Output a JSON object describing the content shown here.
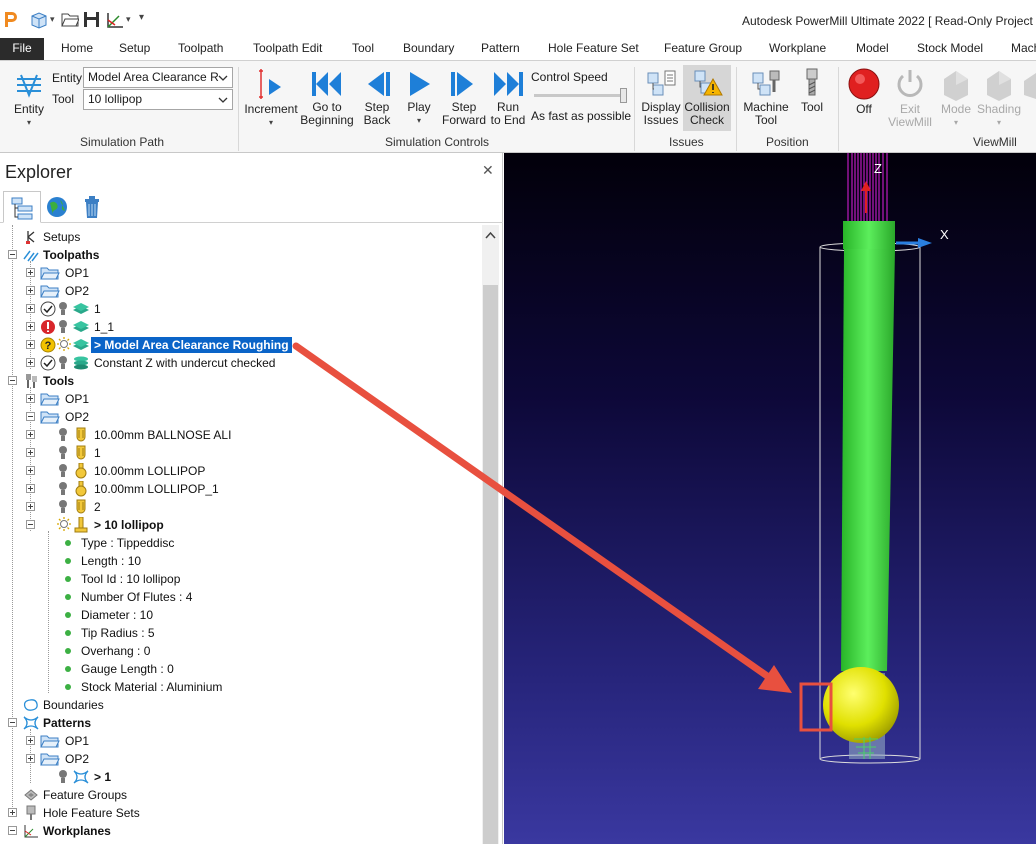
{
  "app": {
    "title": "Autodesk PowerMill Ultimate 2022   [ Read-Only Project *"
  },
  "tabs": [
    {
      "label": "File",
      "active": true
    },
    {
      "label": "Home"
    },
    {
      "label": "Setup"
    },
    {
      "label": "Toolpath"
    },
    {
      "label": "Toolpath Edit"
    },
    {
      "label": "Tool"
    },
    {
      "label": "Boundary"
    },
    {
      "label": "Pattern"
    },
    {
      "label": "Hole Feature Set"
    },
    {
      "label": "Feature Group"
    },
    {
      "label": "Workplane"
    },
    {
      "label": "Model"
    },
    {
      "label": "Stock Model"
    },
    {
      "label": "Mach"
    }
  ],
  "ribbon": {
    "simulation_path": {
      "group_label": "Simulation Path",
      "entity_button": "Entity",
      "entity_label": "Entity",
      "entity_value": "Model Area Clearance R",
      "tool_label": "Tool",
      "tool_value": "10 lollipop"
    },
    "simulation_controls": {
      "group_label": "Simulation Controls",
      "increment": "Increment",
      "go_to_beginning_1": "Go to",
      "go_to_beginning_2": "Beginning",
      "step_back_1": "Step",
      "step_back_2": "Back",
      "play": "Play",
      "step_forward_1": "Step",
      "step_forward_2": "Forward",
      "run_to_end_1": "Run",
      "run_to_end_2": "to End",
      "control_speed": "Control Speed",
      "speed_value": "As fast as possible"
    },
    "issues": {
      "group_label": "Issues",
      "display_issues_1": "Display",
      "display_issues_2": "Issues",
      "collision_check_1": "Collision",
      "collision_check_2": "Check"
    },
    "position": {
      "group_label": "Position",
      "machine_tool_1": "Machine",
      "machine_tool_2": "Tool",
      "tool": "Tool"
    },
    "viewmill": {
      "group_label": "ViewMill",
      "off": "Off",
      "exit_viewmill_1": "Exit",
      "exit_viewmill_2": "ViewMill",
      "mode": "Mode",
      "shading": "Shading"
    }
  },
  "explorer": {
    "title": "Explorer",
    "tree": [
      {
        "label": "Setups"
      },
      {
        "label": "Toolpaths",
        "bold": true
      },
      {
        "label": "OP1"
      },
      {
        "label": "OP2"
      },
      {
        "label": "1"
      },
      {
        "label": "1_1"
      },
      {
        "label": "> Model Area Clearance Roughing",
        "selected": true
      },
      {
        "label": "Constant Z with undercut checked"
      },
      {
        "label": "Tools",
        "bold": true
      },
      {
        "label": "OP1"
      },
      {
        "label": "OP2"
      },
      {
        "label": "10.00mm BALLNOSE ALI"
      },
      {
        "label": "1"
      },
      {
        "label": "10.00mm LOLLIPOP"
      },
      {
        "label": "10.00mm LOLLIPOP_1"
      },
      {
        "label": "2"
      },
      {
        "label": "> 10 lollipop",
        "bold": true
      },
      {
        "label": "Type : Tippeddisc"
      },
      {
        "label": "Length : 10"
      },
      {
        "label": "Tool Id : 10 lollipop"
      },
      {
        "label": "Number Of Flutes : 4"
      },
      {
        "label": "Diameter : 10"
      },
      {
        "label": "Tip Radius : 5"
      },
      {
        "label": "Overhang : 0"
      },
      {
        "label": "Gauge Length : 0"
      },
      {
        "label": "Stock Material : Aluminium"
      },
      {
        "label": "Boundaries"
      },
      {
        "label": "Patterns",
        "bold": true
      },
      {
        "label": "OP1"
      },
      {
        "label": "OP2"
      },
      {
        "label": "> 1",
        "bold": true
      },
      {
        "label": "Feature Groups"
      },
      {
        "label": "Hole Feature Sets"
      },
      {
        "label": "Workplanes",
        "bold": true
      }
    ]
  },
  "viewport": {
    "axis_z": "Z",
    "axis_x": "X"
  },
  "colors": {
    "accent": "#0a64c8",
    "play_blue": "#1e7fd8",
    "stop_red": "#e02020",
    "tool_shank": "#3ed63e",
    "tool_tip": "#e6e600",
    "annotation": "#e8503f"
  }
}
